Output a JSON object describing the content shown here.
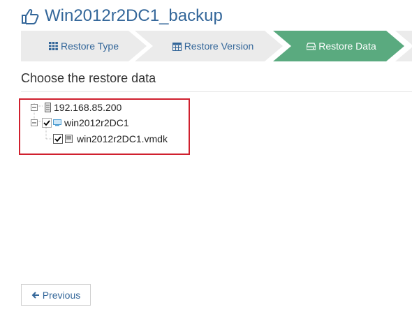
{
  "page": {
    "title": "Win2012r2DC1_backup"
  },
  "wizard": {
    "steps": [
      {
        "label": "Restore Type",
        "icon": "grid-icon",
        "state": "inactive"
      },
      {
        "label": "Restore Version",
        "icon": "calendar-icon",
        "state": "inactive"
      },
      {
        "label": "Restore Data",
        "icon": "drive-icon",
        "state": "active"
      }
    ],
    "colors": {
      "inactive_bg": "#ebebeb",
      "active_bg": "#5aaa7f",
      "inactive_text": "#34679a",
      "active_text": "#ffffff"
    }
  },
  "section": {
    "heading": "Choose the restore data"
  },
  "tree": {
    "host": {
      "label": "192.168.85.200"
    },
    "vm": {
      "label": "win2012r2DC1",
      "checked": true
    },
    "disk": {
      "label": "win2012r2DC1.vmdk",
      "checked": true
    }
  },
  "footer": {
    "previous_label": "Previous"
  },
  "colors": {
    "accent": "#34679a",
    "highlight": "#d0202e"
  }
}
